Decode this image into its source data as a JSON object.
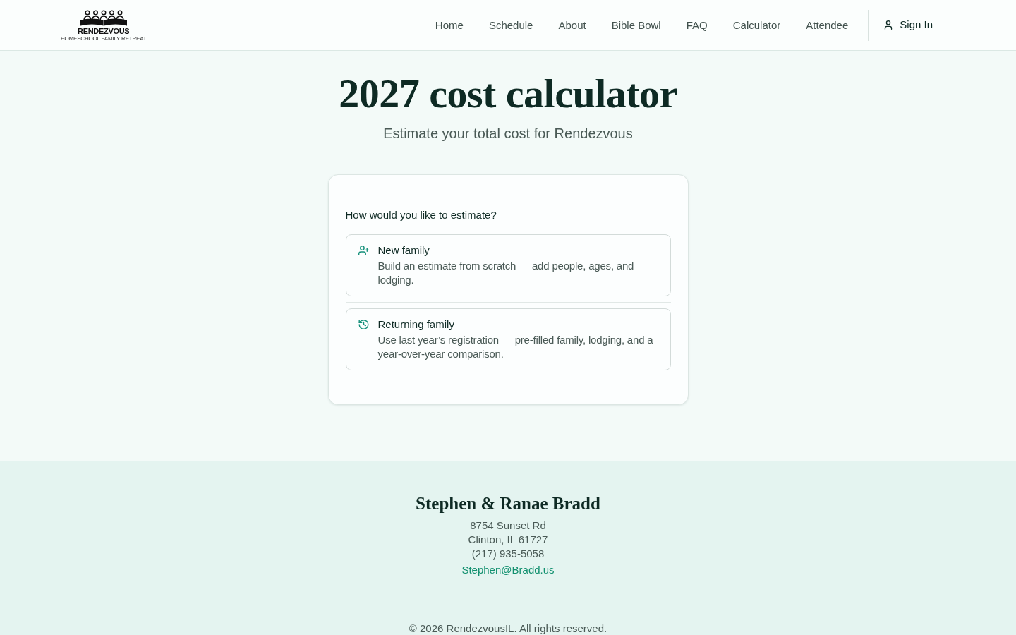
{
  "header": {
    "logo": {
      "wordmark": "RENDEZVOUS",
      "tagline": "HOMESCHOOL FAMILY RETREAT"
    },
    "nav": [
      {
        "label": "Home"
      },
      {
        "label": "Schedule"
      },
      {
        "label": "About"
      },
      {
        "label": "Bible Bowl"
      },
      {
        "label": "FAQ"
      },
      {
        "label": "Calculator"
      },
      {
        "label": "Attendee"
      }
    ],
    "sign_in": "Sign In"
  },
  "hero": {
    "title": "2027 cost calculator",
    "subtitle": "Estimate your total cost for Rendezvous"
  },
  "card": {
    "question": "How would you like to estimate?",
    "options": [
      {
        "kind": "new",
        "title": "New family",
        "description": "Build an estimate from scratch — add people, ages, and lodging."
      },
      {
        "kind": "returning",
        "title": "Returning family",
        "description": "Use last year’s registration — pre-filled family, lodging, and a year-over-year comparison."
      }
    ]
  },
  "footer": {
    "name": "Stephen & Ranae Bradd",
    "address": [
      "8754 Sunset Rd",
      "Clinton, IL 61727",
      "(217) 935-5058"
    ],
    "email": "Stephen@Bradd.us",
    "copyright": "© 2026 RendezvousIL. All rights reserved."
  }
}
